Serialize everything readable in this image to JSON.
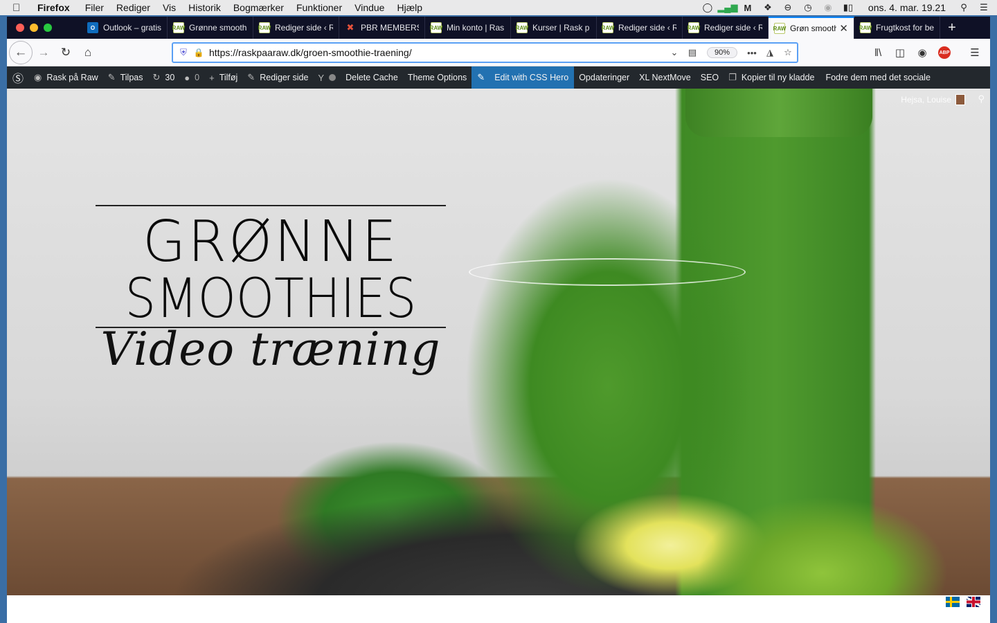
{
  "menubar": {
    "app": "Firefox",
    "items": [
      "Filer",
      "Rediger",
      "Vis",
      "Historik",
      "Bogmærker",
      "Funktioner",
      "Vindue",
      "Hjælp"
    ],
    "clock": "ons. 4. mar. 19.21"
  },
  "tabs": [
    {
      "title": "Outlook – gratis",
      "favicon": "outlook-icon"
    },
    {
      "title": "Grønne smoothies",
      "favicon": "raw-icon"
    },
    {
      "title": "Rediger side ‹ R",
      "favicon": "raw-icon"
    },
    {
      "title": "PBR MEMBERS",
      "favicon": "pbr-icon"
    },
    {
      "title": "Min konto | Ras",
      "favicon": "raw-icon"
    },
    {
      "title": "Kurser | Rask p",
      "favicon": "raw-icon"
    },
    {
      "title": "Rediger side ‹ R",
      "favicon": "raw-icon"
    },
    {
      "title": "Rediger side ‹ R",
      "favicon": "raw-icon"
    },
    {
      "title": "Grøn smoothie",
      "favicon": "raw-icon",
      "active": true
    },
    {
      "title": "Frugtkost for be",
      "favicon": "raw-icon"
    }
  ],
  "navbar": {
    "url": "https://raskpaaraw.dk/groen-smoothie-traening/",
    "zoom": "90%"
  },
  "adminbar": {
    "site": "Rask på Raw",
    "customize": "Tilpas",
    "updates_count": "30",
    "comments_count": "0",
    "new": "Tilføj",
    "edit_page": "Rediger side",
    "delete_cache": "Delete Cache",
    "theme_options": "Theme Options",
    "css_hero": "Edit with CSS Hero",
    "updates": "Opdateringer",
    "nextmove": "XL NextMove",
    "seo": "SEO",
    "copy_draft": "Kopier til ny kladde",
    "social": "Fodre dem med det sociale"
  },
  "hero": {
    "greeting": "Hejsa, Louise",
    "title_line1": "GRØNNE",
    "title_line2": "SMOOTHIES",
    "subtitle": "Video træning"
  },
  "colors": {
    "tabstrip": "#0f1126",
    "adminbar": "#23282d",
    "accent": "#2271b1"
  }
}
